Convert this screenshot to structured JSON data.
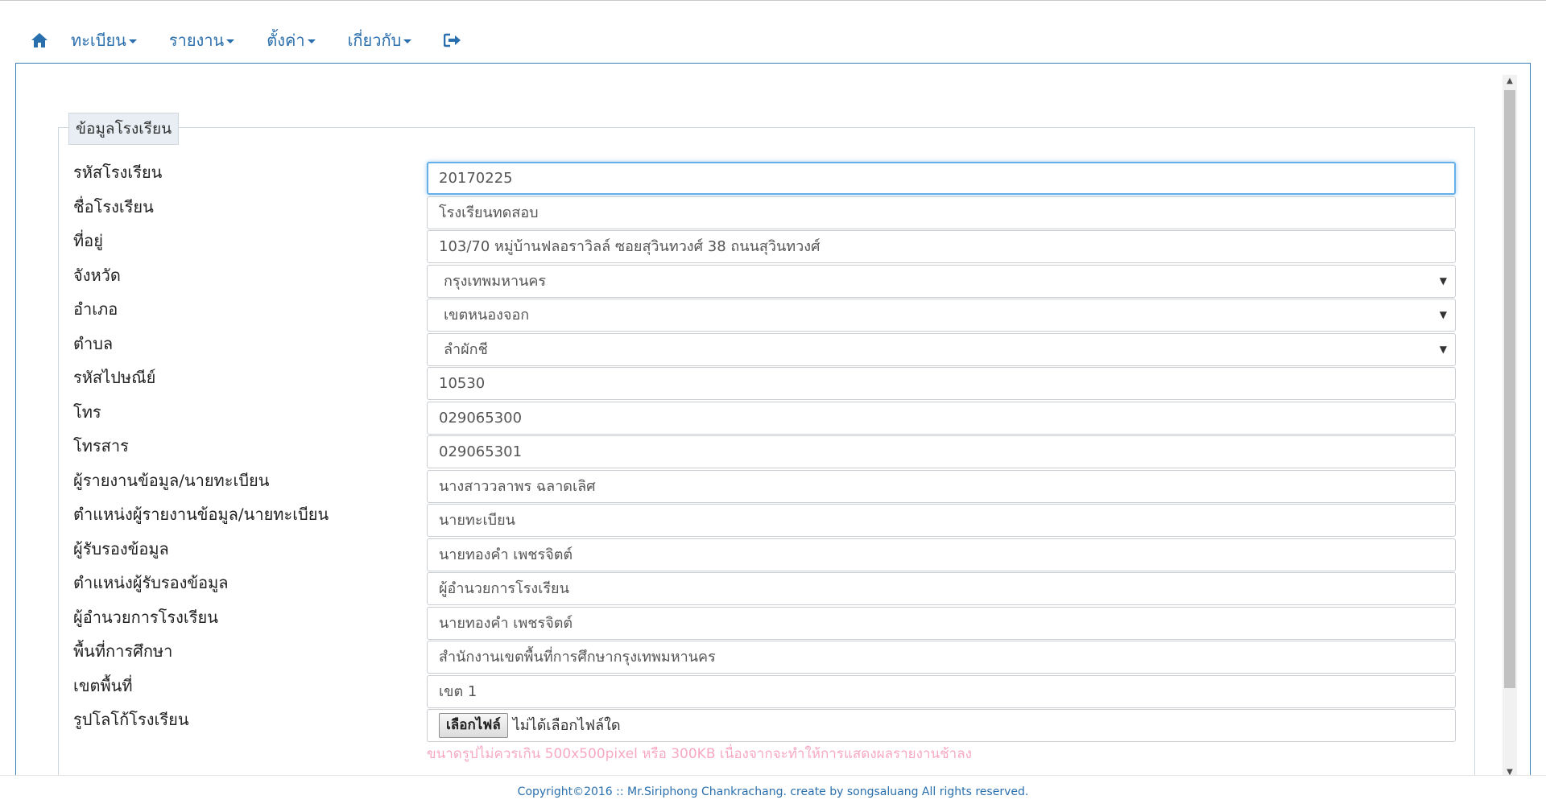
{
  "nav": {
    "items": [
      {
        "label": "ทะเบียน"
      },
      {
        "label": "รายงาน"
      },
      {
        "label": "ตั้งค่า"
      },
      {
        "label": "เกี่ยวกับ"
      }
    ],
    "home_icon": "home-icon",
    "logout_icon": "logout-icon",
    "accent_color": "#2a6fad"
  },
  "form": {
    "legend": "ข้อมูลโรงเรียน",
    "fields": [
      {
        "label": "รหัสโรงเรียน",
        "value": "20170225",
        "type": "text"
      },
      {
        "label": "ชื่อโรงเรียน",
        "value": "โรงเรียนทดสอบ",
        "type": "text"
      },
      {
        "label": "ที่อยู่",
        "value": "103/70 หมู่บ้านฟลอราวิลล์ ซอยสุวินทวงศ์ 38 ถนนสุวินทวงศ์",
        "type": "text"
      },
      {
        "label": "จังหวัด",
        "value": "กรุงเทพมหานคร",
        "type": "select"
      },
      {
        "label": "อำเภอ",
        "value": "เขตหนองจอก",
        "type": "select"
      },
      {
        "label": "ตำบล",
        "value": "ลำผักชี",
        "type": "select"
      },
      {
        "label": "รหัสไปษณีย์",
        "value": "10530",
        "type": "text"
      },
      {
        "label": "โทร",
        "value": "029065300",
        "type": "text"
      },
      {
        "label": "โทรสาร",
        "value": "029065301",
        "type": "text"
      },
      {
        "label": "ผู้รายงานข้อมูล/นายทะเบียน",
        "value": "นางสาววลาพร  ฉลาดเลิศ",
        "type": "text"
      },
      {
        "label": "ตำแหน่งผู้รายงานข้อมูล/นายทะเบียน",
        "value": "นายทะเบียน",
        "type": "text"
      },
      {
        "label": "ผู้รับรองข้อมูล",
        "value": "นายทองคำ  เพชรจิตต์",
        "type": "text"
      },
      {
        "label": "ตำแหน่งผู้รับรองข้อมูล",
        "value": "ผู้อำนวยการโรงเรียน",
        "type": "text"
      },
      {
        "label": "ผู้อำนวยการโรงเรียน",
        "value": "นายทองคำ  เพชรจิตต์",
        "type": "text"
      },
      {
        "label": "พื้นที่การศึกษา",
        "value": "สำนักงานเขตพื้นที่การศึกษากรุงเทพมหานคร",
        "type": "text"
      },
      {
        "label": "เขตพื้นที่",
        "value": "เขต 1",
        "type": "text"
      }
    ],
    "logo": {
      "label": "รูปโลโก้โรงเรียน",
      "button_label": "เลือกไฟล์",
      "no_file_text": "ไม่ได้เลือกไฟล์ใด",
      "hint": "ขนาดรูปไม่ควรเกิน 500x500pixel หรือ 300KB เนื่องจากจะทำให้การแสดงผลรายงานช้าลง",
      "hint_color": "#f7a8c4"
    }
  },
  "footer": {
    "text": "Copyright©2016 :: Mr.Siriphong Chankrachang. create by songsaluang All rights reserved."
  }
}
